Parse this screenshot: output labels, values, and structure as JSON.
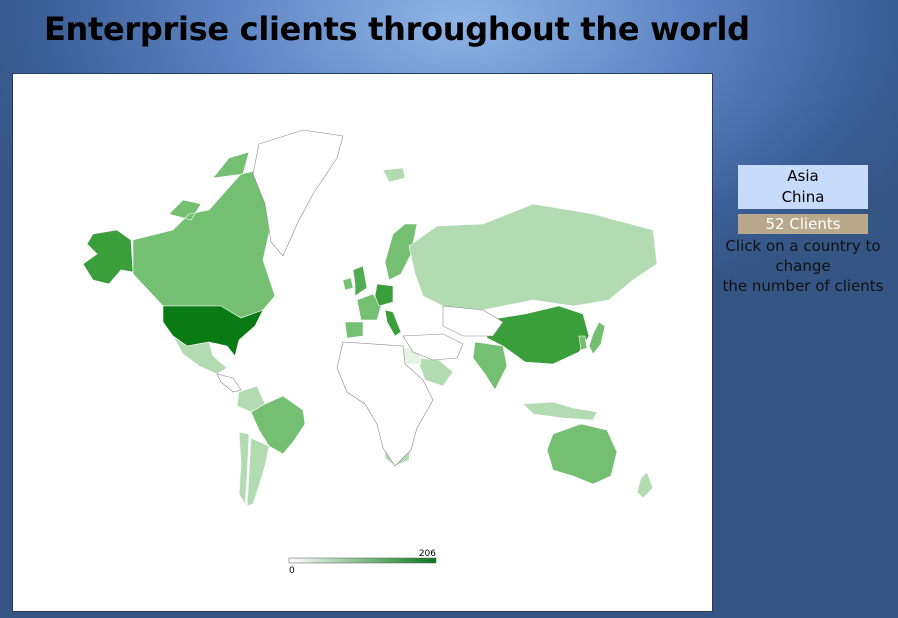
{
  "page": {
    "title": "Enterprise clients throughout the world"
  },
  "selection": {
    "continent": "Asia",
    "country": "China",
    "clients_label": "52 Clients"
  },
  "hint": {
    "line1": "Click on a country to",
    "line2": "change",
    "line3": "the number of clients"
  },
  "legend": {
    "min_label": "0",
    "max_label": "206",
    "color_low": "#ffffff",
    "color_high": "#0a7a1a"
  },
  "map": {
    "type": "choropleth",
    "metric": "clients",
    "scale": [
      0,
      206
    ],
    "countries": [
      {
        "name": "Alaska (USA)",
        "level": "high"
      },
      {
        "name": "Canada",
        "level": "medium"
      },
      {
        "name": "Greenland",
        "level": "none"
      },
      {
        "name": "United States",
        "level": "very-high"
      },
      {
        "name": "Mexico",
        "level": "low"
      },
      {
        "name": "Central America",
        "level": "none"
      },
      {
        "name": "Brazil",
        "level": "medium"
      },
      {
        "name": "Argentina",
        "level": "low"
      },
      {
        "name": "Chile",
        "level": "low"
      },
      {
        "name": "Colombia",
        "level": "low"
      },
      {
        "name": "Iceland",
        "level": "low"
      },
      {
        "name": "United Kingdom",
        "level": "medium-high"
      },
      {
        "name": "Ireland",
        "level": "medium"
      },
      {
        "name": "France",
        "level": "medium"
      },
      {
        "name": "Germany",
        "level": "high"
      },
      {
        "name": "Italy",
        "level": "high"
      },
      {
        "name": "Spain",
        "level": "medium"
      },
      {
        "name": "Scandinavia",
        "level": "medium"
      },
      {
        "name": "Russia",
        "level": "low"
      },
      {
        "name": "China",
        "level": "high"
      },
      {
        "name": "India",
        "level": "medium"
      },
      {
        "name": "Japan",
        "level": "medium"
      },
      {
        "name": "Korea",
        "level": "medium"
      },
      {
        "name": "Saudi Arabia",
        "level": "low"
      },
      {
        "name": "Egypt",
        "level": "very-low"
      },
      {
        "name": "South Africa",
        "level": "low"
      },
      {
        "name": "Australia",
        "level": "medium"
      },
      {
        "name": "New Zealand",
        "level": "low"
      },
      {
        "name": "Indonesia",
        "level": "low"
      },
      {
        "name": "Africa (other)",
        "level": "none"
      },
      {
        "name": "Middle East (other)",
        "level": "none"
      },
      {
        "name": "Central Asia",
        "level": "none"
      }
    ],
    "palette": {
      "none": "#ffffff",
      "very-low": "#e5f3e2",
      "low": "#b3dbb2",
      "medium": "#74bf72",
      "medium-high": "#52ad52",
      "high": "#3a9e3b",
      "very-high": "#0a7a14"
    }
  }
}
